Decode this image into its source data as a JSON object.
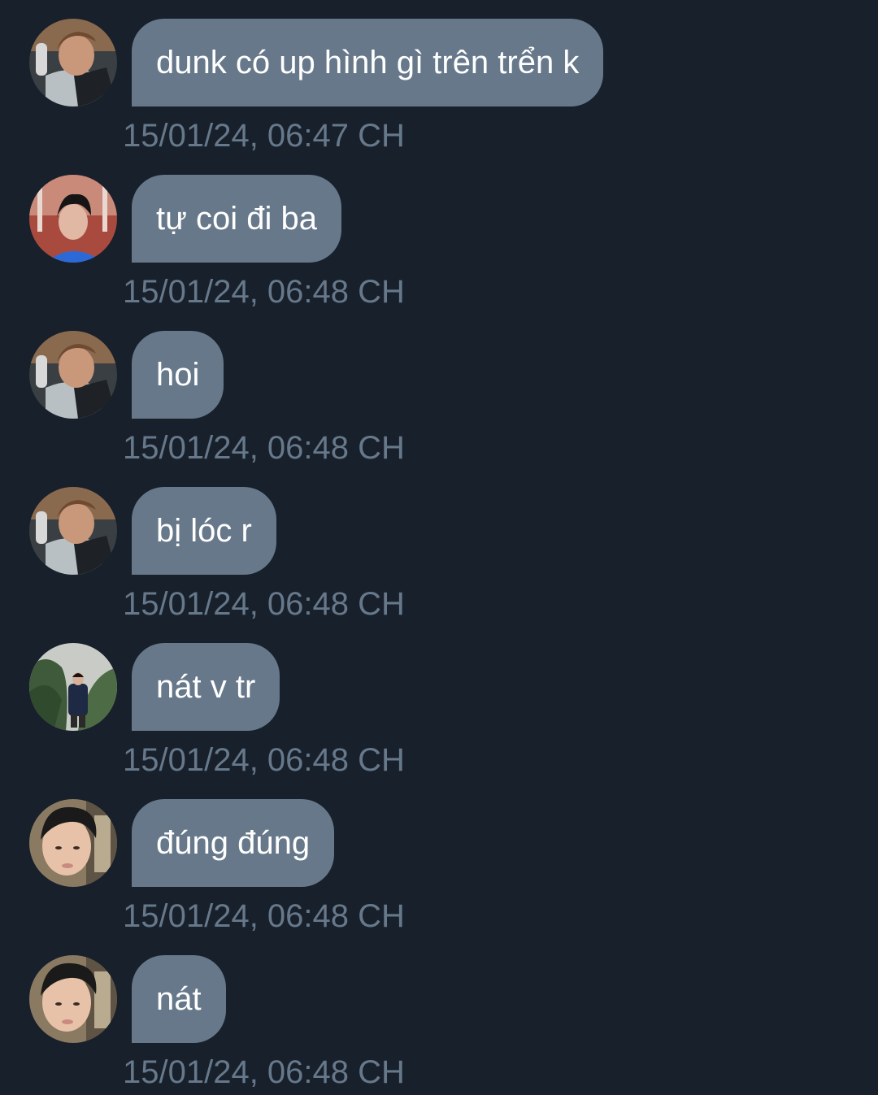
{
  "colors": {
    "background": "#17202b",
    "bubble": "#66788a",
    "bubble_text": "#ffffff",
    "timestamp": "#66788a"
  },
  "messages": [
    {
      "avatar": "avatar-a",
      "text": "dunk có up hình gì trên trển k",
      "time": "15/01/24, 06:47 CH"
    },
    {
      "avatar": "avatar-b",
      "text": "tự coi đi ba",
      "time": "15/01/24, 06:48 CH"
    },
    {
      "avatar": "avatar-a",
      "text": "hoi",
      "time": "15/01/24, 06:48 CH"
    },
    {
      "avatar": "avatar-a",
      "text": "bị lóc r",
      "time": "15/01/24, 06:48 CH"
    },
    {
      "avatar": "avatar-c",
      "text": "nát v tr",
      "time": "15/01/24, 06:48 CH"
    },
    {
      "avatar": "avatar-d",
      "text": "đúng đúng",
      "time": "15/01/24, 06:48 CH"
    },
    {
      "avatar": "avatar-d",
      "text": "nát",
      "time": "15/01/24, 06:48 CH"
    }
  ]
}
